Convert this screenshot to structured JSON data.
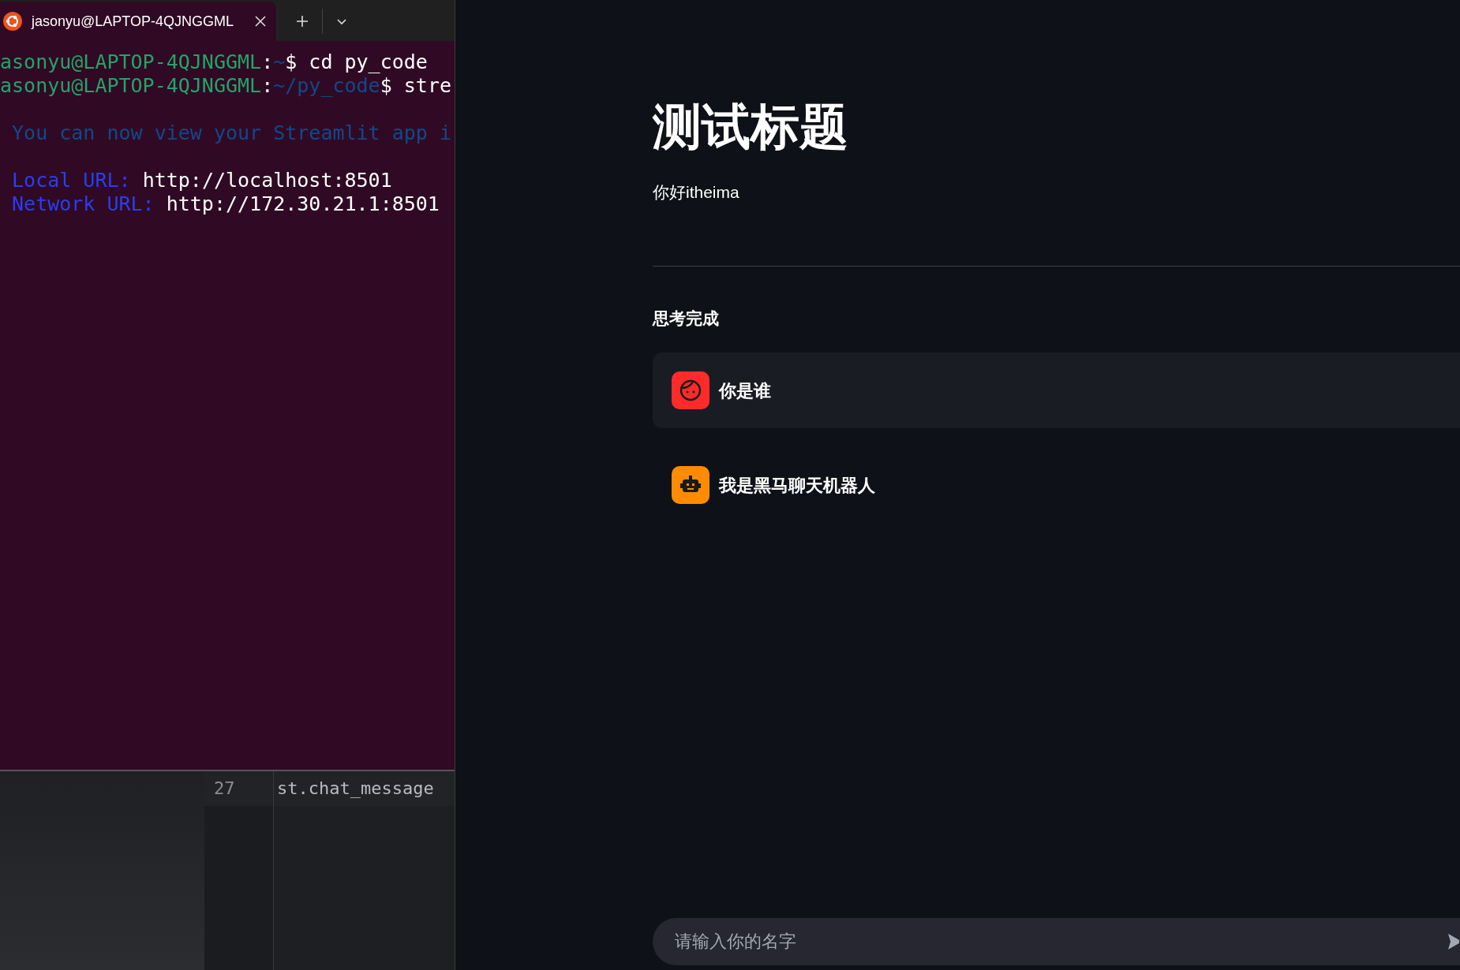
{
  "terminal": {
    "tab": {
      "title": "jasonyu@LAPTOP-4QJNGGML",
      "selected": true
    },
    "lines": [
      {
        "kind": "text",
        "segments": [
          {
            "kind": "user",
            "text": "asonyu@LAPTOP-4QJNGGML"
          },
          {
            "kind": "plain",
            "text": ":"
          },
          {
            "kind": "path",
            "text": "~"
          },
          {
            "kind": "plain",
            "text": "$ cd py_code"
          }
        ]
      },
      {
        "kind": "text",
        "segments": [
          {
            "kind": "user",
            "text": "asonyu@LAPTOP-4QJNGGML"
          },
          {
            "kind": "plain",
            "text": ":"
          },
          {
            "kind": "path",
            "text": "~/py_code"
          },
          {
            "kind": "plain",
            "text": "$ stre"
          }
        ]
      },
      {
        "kind": "blank"
      },
      {
        "kind": "text",
        "segments": [
          {
            "kind": "info",
            "text": " You can now view your Streamlit app i"
          }
        ]
      },
      {
        "kind": "blank"
      },
      {
        "kind": "text",
        "segments": [
          {
            "kind": "label",
            "text": " Local URL: "
          },
          {
            "kind": "plain",
            "text": "http://localhost:8501"
          }
        ]
      },
      {
        "kind": "text",
        "segments": [
          {
            "kind": "label",
            "text": " Network URL: "
          },
          {
            "kind": "plain",
            "text": "http://172.30.21.1:8501"
          }
        ]
      }
    ]
  },
  "editor": {
    "line_number": "27",
    "code": "st.chat_message"
  },
  "app": {
    "title": "测试标题",
    "subtitle": "你好itheima",
    "status": "思考完成",
    "messages": [
      {
        "kind": "user",
        "text": "你是谁"
      },
      {
        "kind": "assistant",
        "text": "我是黑马聊天机器人"
      }
    ],
    "chat_input": {
      "placeholder": "请输入你的名字"
    }
  }
}
